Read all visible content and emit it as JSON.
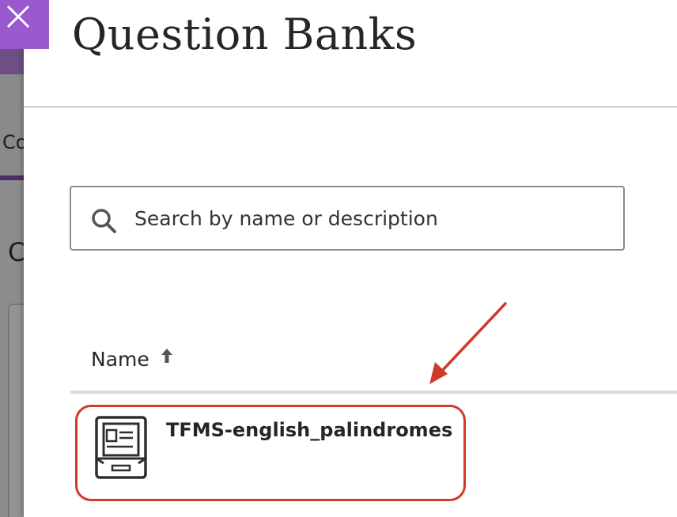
{
  "background_page": {
    "tab_fragment": "Co",
    "heading_fragment": "C"
  },
  "close_button": {
    "icon": "close-icon",
    "color": "#9b59d0"
  },
  "panel": {
    "title": "Question Banks"
  },
  "search": {
    "placeholder": "Search by name or description",
    "value": "",
    "icon": "search-icon"
  },
  "table": {
    "columns": [
      {
        "label": "Name",
        "sort": "ascending",
        "icon": "arrow-up-icon"
      }
    ],
    "rows": [
      {
        "name": "TFMS-english_palindromes",
        "icon": "question-bank-icon"
      }
    ]
  },
  "annotation": {
    "color": "#cf3a29"
  }
}
